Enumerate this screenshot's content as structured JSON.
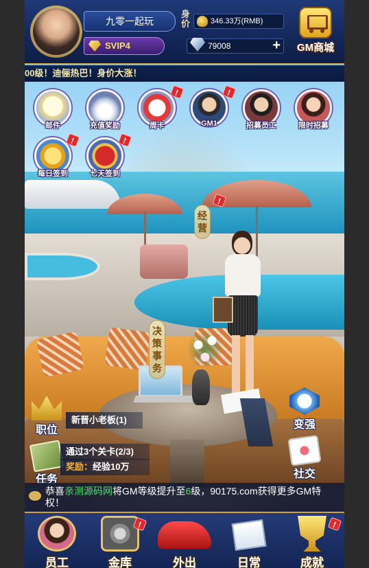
{
  "header": {
    "player_name": "九零一起玩",
    "vip_level": "SVIP4",
    "worth_label": "身价",
    "worth_value": "346.33万(RMB)",
    "diamonds": "79008",
    "add_symbol": "+",
    "shop_label": "GM商城"
  },
  "marquee": {
    "text": "00级！迪俪热巴！身价大涨！"
  },
  "menu": {
    "items": [
      {
        "label": "邮件",
        "icon": "mail-icon",
        "badge": ""
      },
      {
        "label": "充值奖励",
        "icon": "diamond-pile-icon",
        "badge": ""
      },
      {
        "label": "周卡",
        "icon": "calendar-icon",
        "badge": "!"
      },
      {
        "label": "GM1",
        "icon": "gm-avatar-icon",
        "badge": "!"
      },
      {
        "label": "招募员工",
        "icon": "recruit-avatar-icon",
        "badge": ""
      },
      {
        "label": "限时招募",
        "icon": "limited-recruit-icon",
        "badge": ""
      },
      {
        "label": "每日签到",
        "icon": "daily-signin-icon",
        "badge": "!"
      },
      {
        "label": "七天签到",
        "icon": "seven-day-signin-icon",
        "badge": "!"
      }
    ]
  },
  "scene": {
    "operate_label": "经营",
    "operate_badge": "!",
    "decision_label": "决策事务"
  },
  "left_actions": {
    "position_label": "职位",
    "position_info": "新晋小老板(1)",
    "task_label": "任务",
    "task_desc": "通过3个关卡(2/3)",
    "task_reward_label": "奖励：",
    "task_reward_value": "经验10万"
  },
  "right_actions": {
    "strong_label": "变强",
    "social_label": "社交"
  },
  "notice": {
    "prefix": "恭喜",
    "name": "亲测源码网",
    "middle": "将GM等级提升至",
    "level": "6",
    "suffix": "级，90175.com获得更多GM特权！"
  },
  "bottom_nav": {
    "items": [
      {
        "label": "员工",
        "icon": "staff-icon",
        "badge": ""
      },
      {
        "label": "金库",
        "icon": "vault-icon",
        "badge": "!"
      },
      {
        "label": "外出",
        "icon": "car-icon",
        "badge": ""
      },
      {
        "label": "日常",
        "icon": "daily-letter-icon",
        "badge": ""
      },
      {
        "label": "成就",
        "icon": "trophy-icon",
        "badge": "!"
      }
    ]
  },
  "colors": {
    "header_blue": "#13275a",
    "gold_border": "#c9a24a",
    "badge_red": "#e5262b",
    "notice_green": "#47e36b"
  }
}
